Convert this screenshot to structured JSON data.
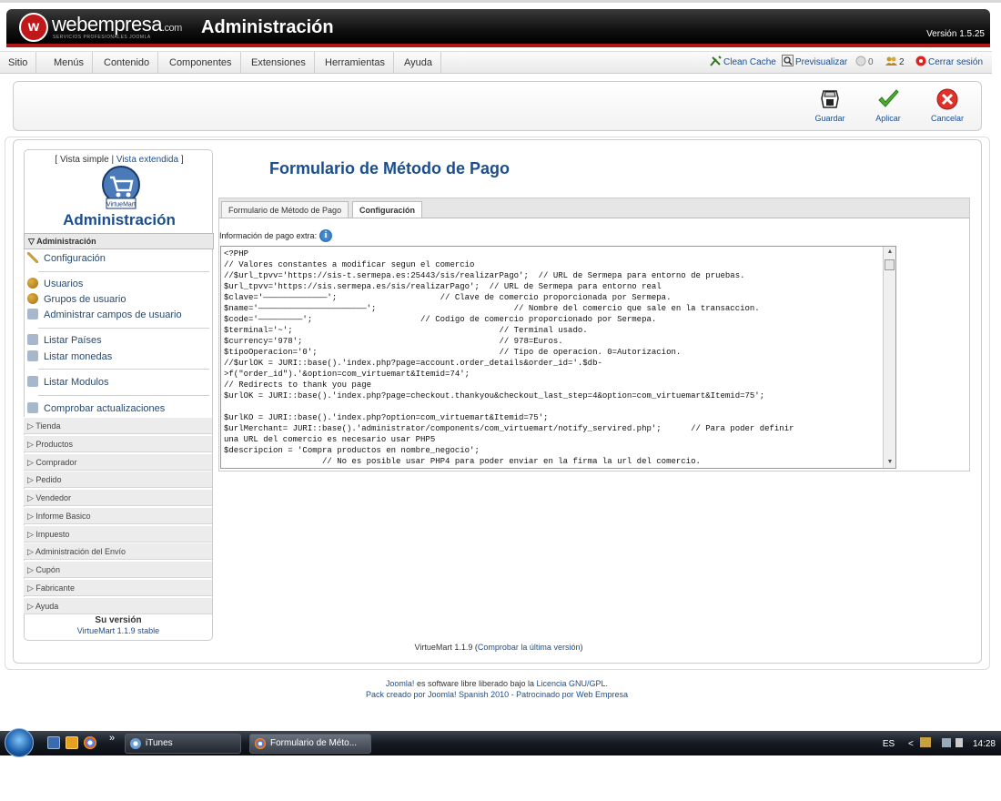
{
  "header": {
    "logo_initial": "w",
    "logo_name": "webempresa",
    "logo_domain": ".com",
    "logo_tagline": "SERVICIOS PROFESIONALES JOOMLA",
    "title": "Administración",
    "version": "Versión 1.5.25"
  },
  "menubar": {
    "items": [
      "Sitio",
      "Menús",
      "Contenido",
      "Componentes",
      "Extensiones",
      "Herramientas",
      "Ayuda"
    ],
    "clean_cache": "Clean Cache",
    "preview": "Previsualizar",
    "messages_count": "0",
    "users_count": "2",
    "logout": "Cerrar sesión"
  },
  "toolbar": {
    "save": "Guardar",
    "apply": "Aplicar",
    "cancel": "Cancelar"
  },
  "sidebar": {
    "vista_simple": "[ Vista simple |",
    "vista_extendida": "Vista extendida",
    "vista_close": "]",
    "logo_label": "VirtueMart",
    "admin_title": "Administración",
    "section_head": "Administración",
    "items": [
      "Configuración",
      "Usuarios",
      "Grupos de usuario",
      "Administrar campos de usuario",
      "Listar Países",
      "Listar monedas",
      "Listar Modulos",
      "Comprobar actualizaciones"
    ],
    "categories": [
      "Tienda",
      "Productos",
      "Comprador",
      "Pedido",
      "Vendedor",
      "Informe Basico",
      "Impuesto",
      "Administración del Envío",
      "Cupón",
      "Fabricante",
      "Ayuda"
    ],
    "su_version_label": "Su versión",
    "su_version_value": "VirtueMart 1.1.9 stable"
  },
  "main": {
    "title": "Formulario de Método de Pago",
    "tabs": [
      "Formulario de Método de Pago",
      "Configuración"
    ],
    "info_label": "Información de pago extra:",
    "code": "<?PHP\n// Valores constantes a modificar segun el comercio\n//$url_tpvv='https://sis-t.sermepa.es:25443/sis/realizarPago';  // URL de Sermepa para entorno de pruebas.\n$url_tpvv='https://sis.sermepa.es/sis/realizarPago';  // URL de Sermepa para entorno real\n$clave='—————————————';                     // Clave de comercio proporcionada por Sermepa.\n$name='——————————————————————';                            // Nombre del comercio que sale en la transaccion.\n$code='—————————';                      // Codigo de comercio proporcionado por Sermepa.\n$terminal='~';                                          // Terminal usado.\n$currency='978';                                        // 978=Euros.\n$tipoOperacion='0';                                     // Tipo de operacion. 0=Autorizacion.\n//$urlOK = JURI::base().'index.php?page=account.order_details&order_id='.$db-\n>f(\"order_id\").'&option=com_virtuemart&Itemid=74';\n// Redirects to thank you page\n$urlOK = JURI::base().'index.php?page=checkout.thankyou&checkout_last_step=4&option=com_virtuemart&Itemid=75';\n\n$urlKO = JURI::base().'index.php?option=com_virtuemart&Itemid=75';\n$urlMerchant= JURI::base().'administrator/components/com_virtuemart/notify_servired.php';      // Para poder definir\nuna URL del comercio es necesario usar PHP5\n$descripcion = 'Compra productos en nombre_negocio';\n                    // No es posible usar PHP4 para poder enviar en la firma la url del comercio.",
    "vm_version": "VirtueMart 1.1.9 (",
    "vm_check": "Comprobar la última versión",
    "vm_close": ")"
  },
  "footer": {
    "joomla": "Joomla!",
    "line1_mid": " es software libre liberado bajo la ",
    "license": "Licencia GNU/GPL",
    "line1_end": ".",
    "line2": "Pack creado por Joomla! Spanish 2010 - Patrocinado por Web Empresa"
  },
  "taskbar": {
    "chevron": "»",
    "task1": "iTunes",
    "task2": "Formulario de Méto...",
    "lang": "ES",
    "tray_arrow": "<",
    "time": "14:28"
  }
}
